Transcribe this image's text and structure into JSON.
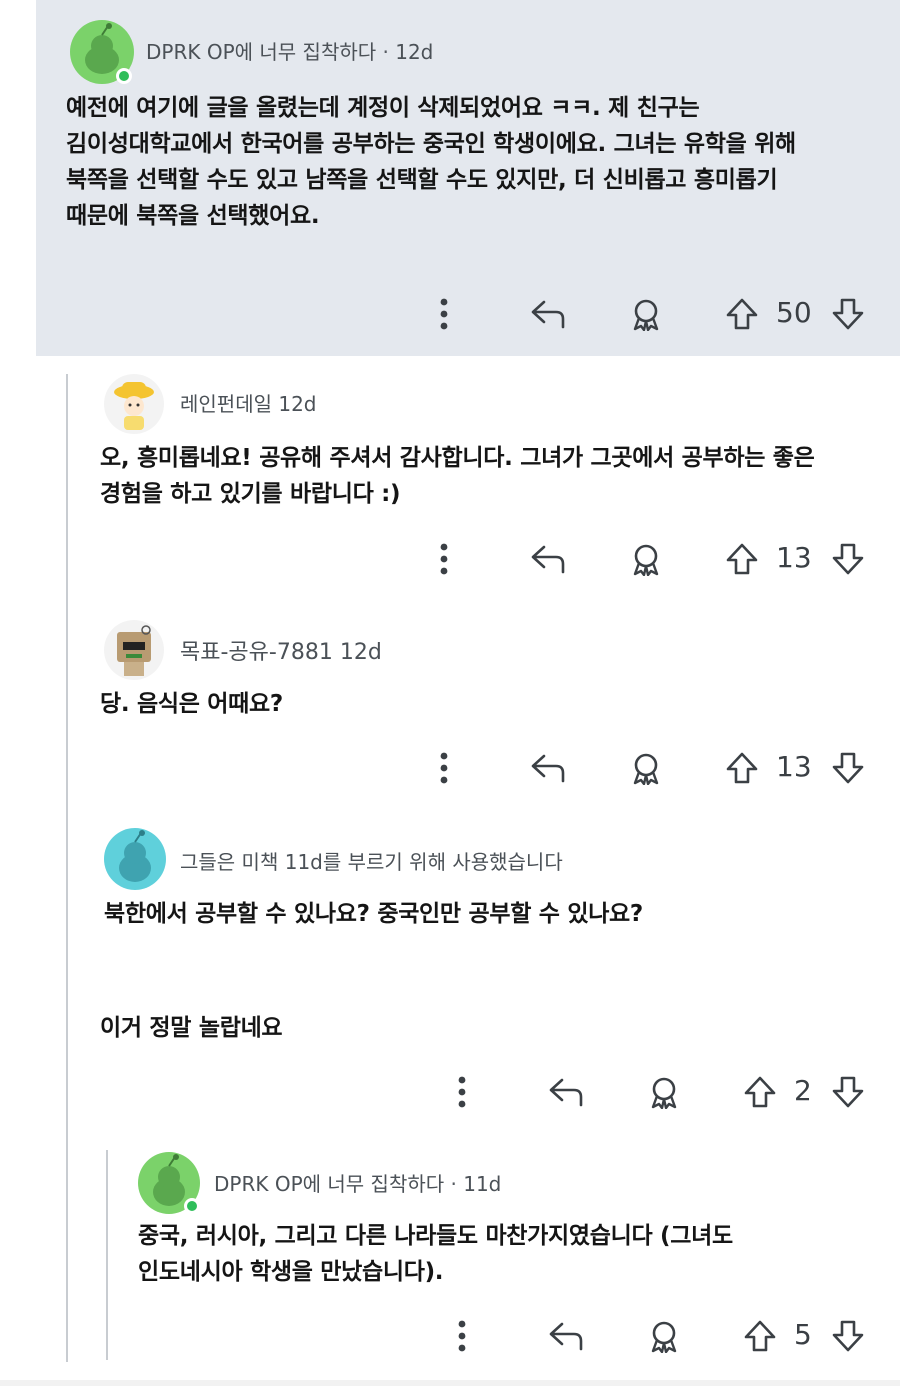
{
  "comments": [
    {
      "username": "DPRK OP에 너무 집착하다",
      "separator": "·",
      "time": "12d",
      "text_lines": [
        "예전에 여기에 글을 올렸는데 계정이 삭제되었어요 ㅋㅋ. 제 친구는",
        "김이성대학교에서 한국어를 공부하는 중국인 학생이에요. 그녀는 유학을 위해",
        "북쪽을 선택할 수도 있고 남쪽을 선택할 수도 있지만, 더 신비롭고 흥미롭기",
        "때문에 북쪽을 선택했어요."
      ],
      "votes": "50",
      "avatar_icon": "reddit-snoo-avatar-green"
    },
    {
      "username": "레인펀데일",
      "time": "12d",
      "text_lines": [
        "오, 흥미롭네요! 공유해 주셔서 감사합니다. 그녀가 그곳에서 공부하는 좋은",
        "경험을 하고 있기를 바랍니다 :)"
      ],
      "votes": "13",
      "avatar_icon": "girl-avatar-yellow-hat"
    },
    {
      "username": "목표-공유-7881",
      "time": "12d",
      "text_lines": [
        "당. 음식은 어때요?"
      ],
      "votes": "13",
      "avatar_icon": "box-robot-avatar"
    },
    {
      "username_line": "그들은 미책 11d를 부르기 위해 사용했습니다",
      "text_lines": [
        "북한에서 공부할 수 있나요? 중국인만 공부할 수 있나요?",
        "",
        "이거 정말 놀랍네요"
      ],
      "votes": "2",
      "avatar_icon": "reddit-snoo-avatar-teal"
    },
    {
      "username": "DPRK OP에 너무 집착하다",
      "separator": "·",
      "time": "11d",
      "text_lines": [
        "중국, 러시아, 그리고 다른 나라들도 마찬가지였습니다 (그녀도",
        "인도네시아 학생을 만났습니다)."
      ],
      "votes": "5",
      "avatar_icon": "reddit-snoo-avatar-green"
    }
  ],
  "icons": {
    "more": "more-vertical-icon",
    "reply": "reply-arrow-icon",
    "award": "award-ribbon-icon",
    "upvote": "upvote-arrow-icon",
    "downvote": "downvote-arrow-icon"
  },
  "colors": {
    "op_highlight_bg": "#e4e8ee",
    "snoo_green": "#7bd26a",
    "snoo_teal": "#5fd0db",
    "online_green": "#2fbe5a",
    "thread_line": "#c8ccd1"
  }
}
